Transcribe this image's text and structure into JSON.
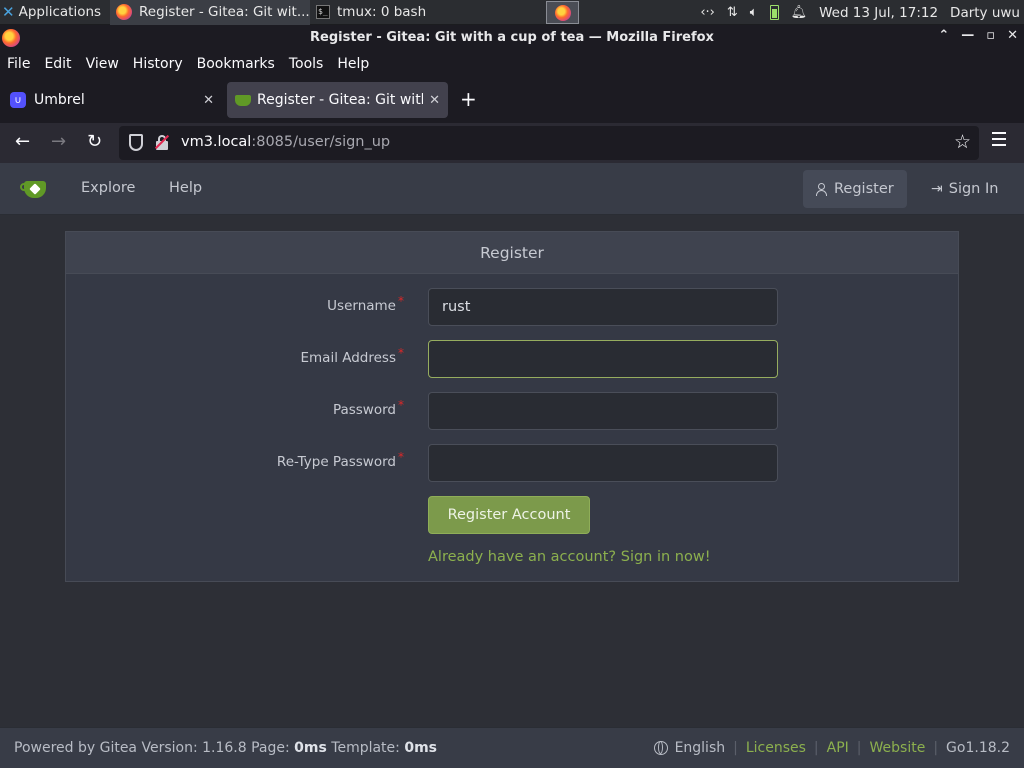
{
  "panel": {
    "apps_label": "Applications",
    "tasks": [
      {
        "title": "Register - Gitea: Git wit..."
      },
      {
        "title": "tmux: 0 bash"
      }
    ],
    "clock": "Wed 13 Jul, 17:12",
    "user": "Darty uwu"
  },
  "window": {
    "title": "Register - Gitea: Git with a cup of tea — Mozilla Firefox"
  },
  "menu": [
    "File",
    "Edit",
    "View",
    "History",
    "Bookmarks",
    "Tools",
    "Help"
  ],
  "tabs": [
    {
      "title": "Umbrel"
    },
    {
      "title": "Register - Gitea: Git with"
    }
  ],
  "url": {
    "host": "vm3.local",
    "rest": ":8085/user/sign_up"
  },
  "header": {
    "explore": "Explore",
    "help": "Help",
    "register": "Register",
    "signin": "Sign In"
  },
  "form": {
    "title": "Register",
    "username_label": "Username",
    "username_value": "rust",
    "email_label": "Email Address",
    "email_value": "",
    "password_label": "Password",
    "retype_label": "Re-Type Password",
    "submit": "Register Account",
    "signin_link": "Already have an account? Sign in now!"
  },
  "footer": {
    "powered": "Powered by Gitea Version: 1.16.8 Page:",
    "page_time": "0ms",
    "template_label": "Template:",
    "template_time": "0ms",
    "language": "English",
    "licenses": "Licenses",
    "api": "API",
    "website": "Website",
    "go_version": "Go1.18.2"
  },
  "colors": {
    "accent": "#609926",
    "link": "#8cb04e",
    "button": "#7c9a4b",
    "required": "#db2828"
  }
}
